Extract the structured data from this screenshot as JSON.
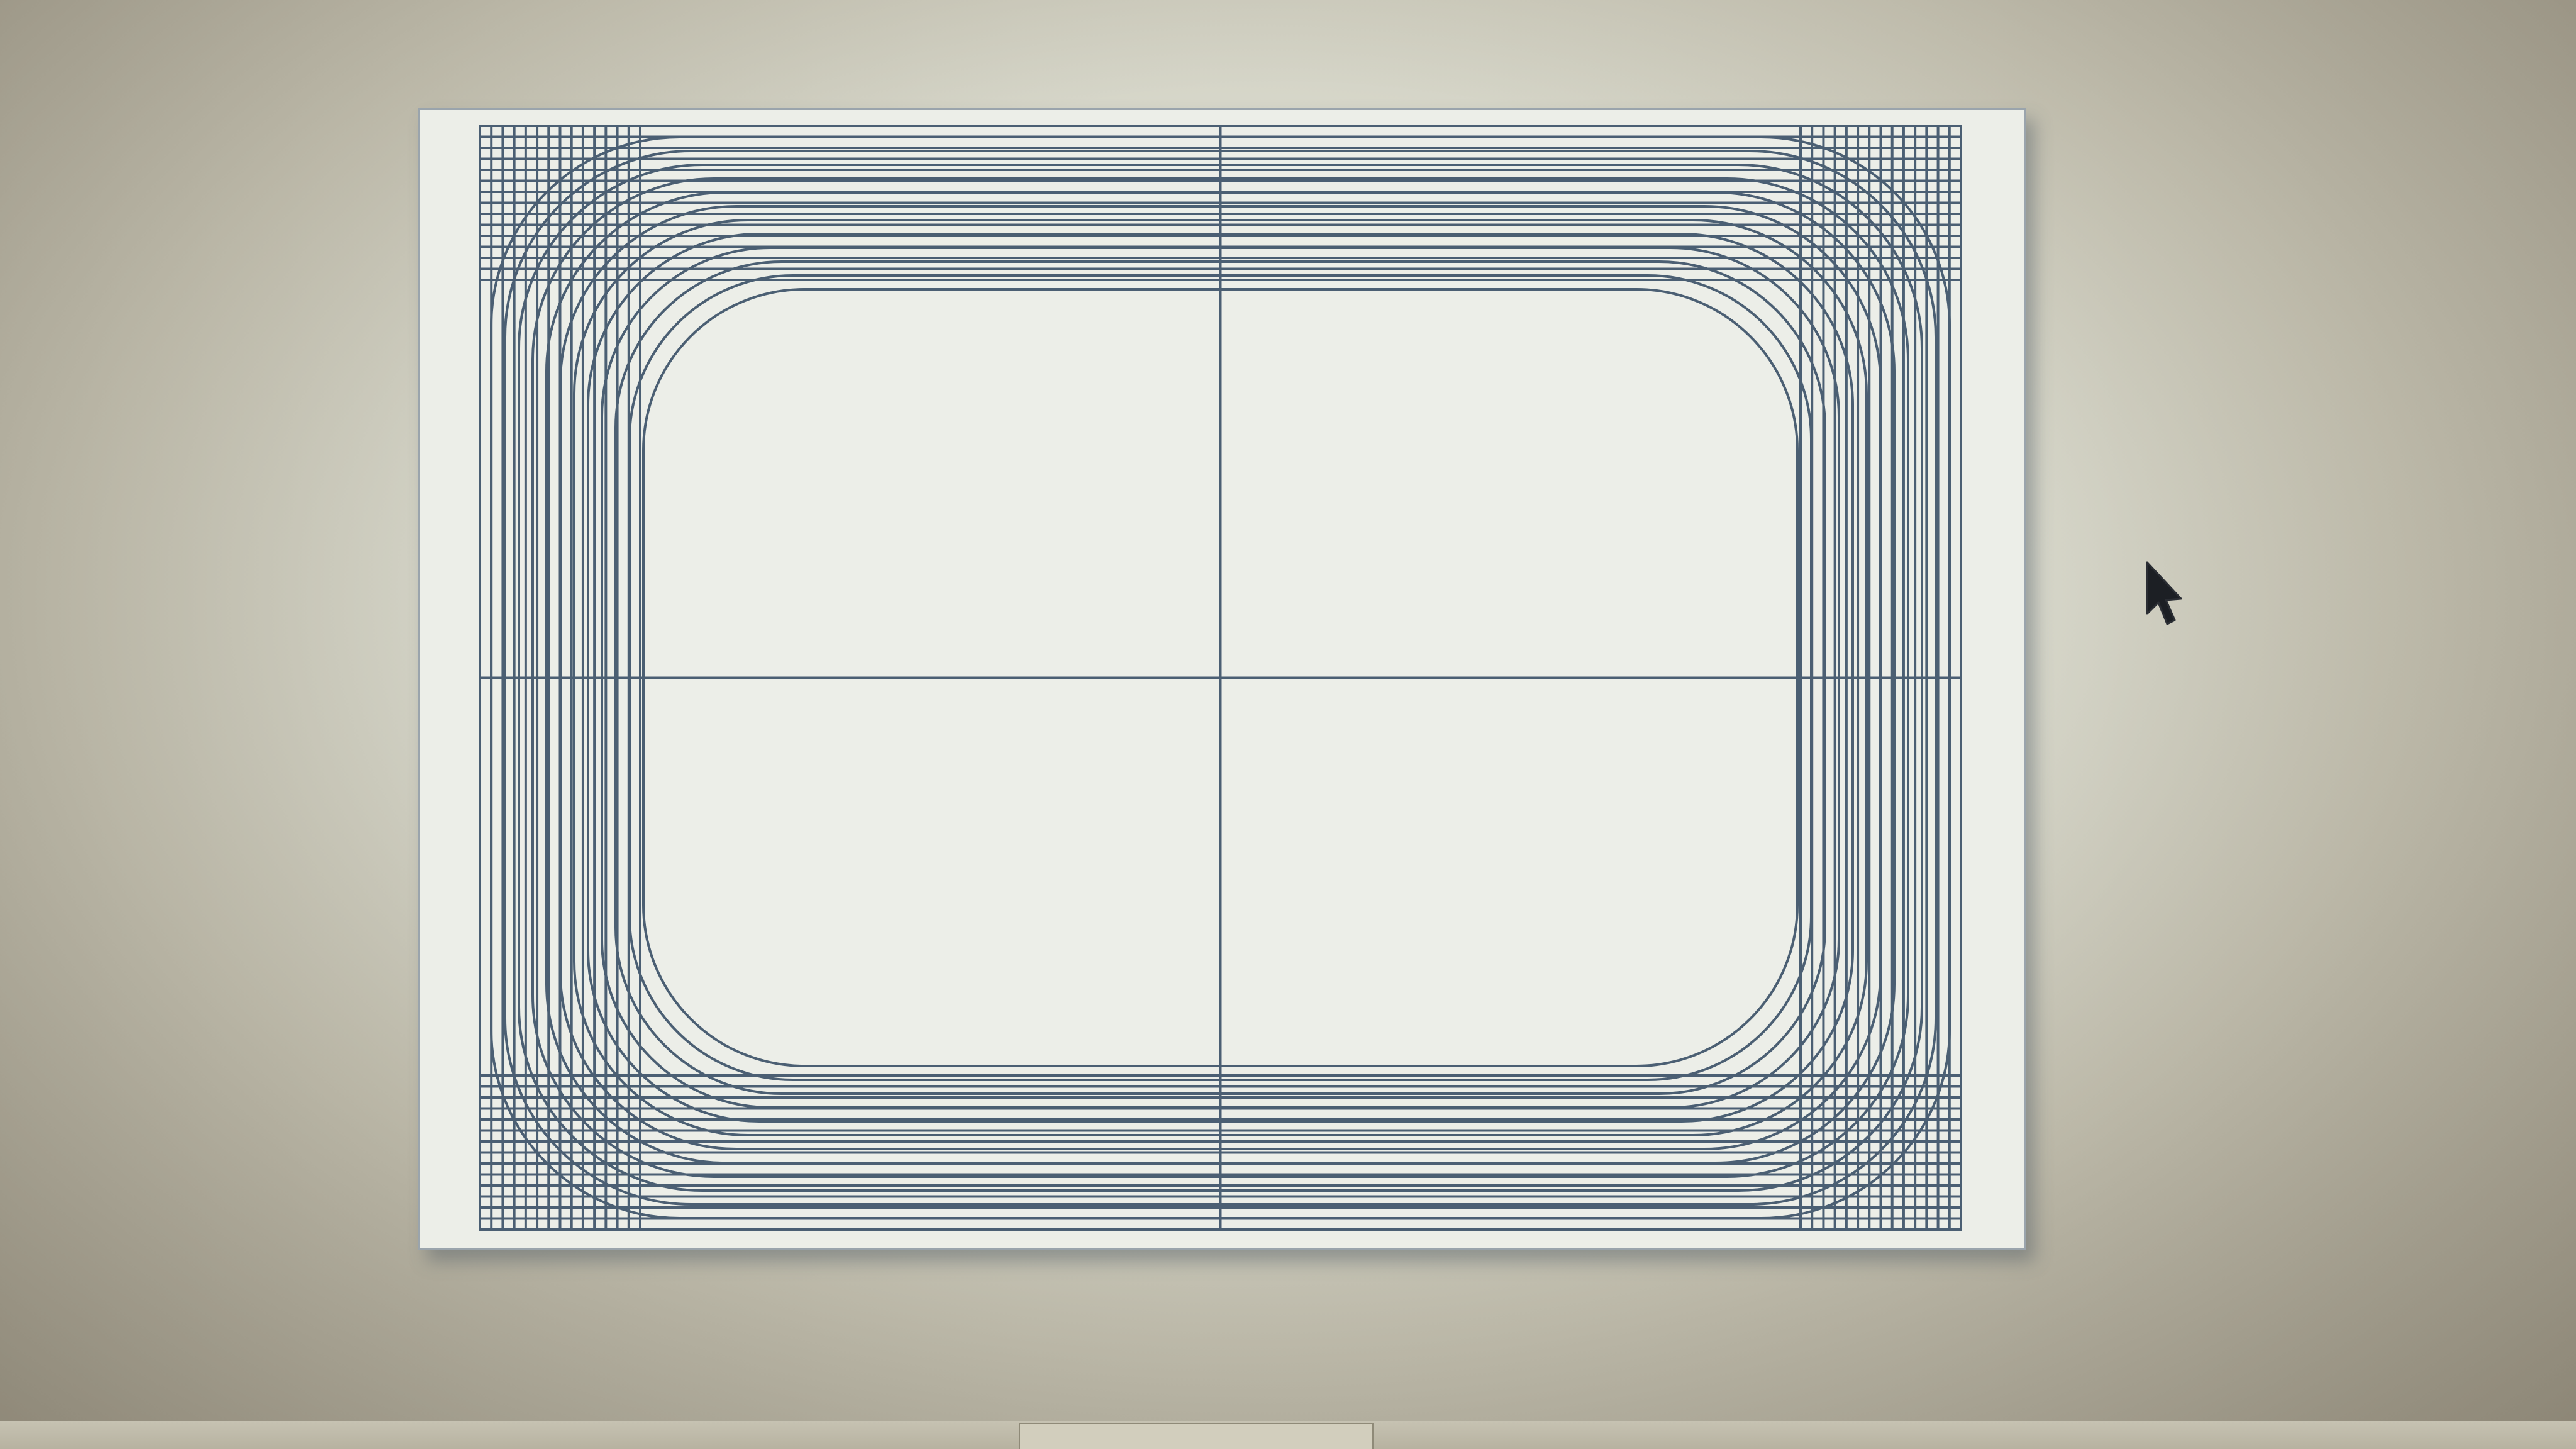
{
  "document": {
    "figure": "grid-distortion-test-pattern",
    "stroke_color": "#4b5f73",
    "background_color": "#eceee8"
  },
  "cursor": {
    "icon": "arrow-pointer-icon",
    "color": "#1c1f24"
  }
}
